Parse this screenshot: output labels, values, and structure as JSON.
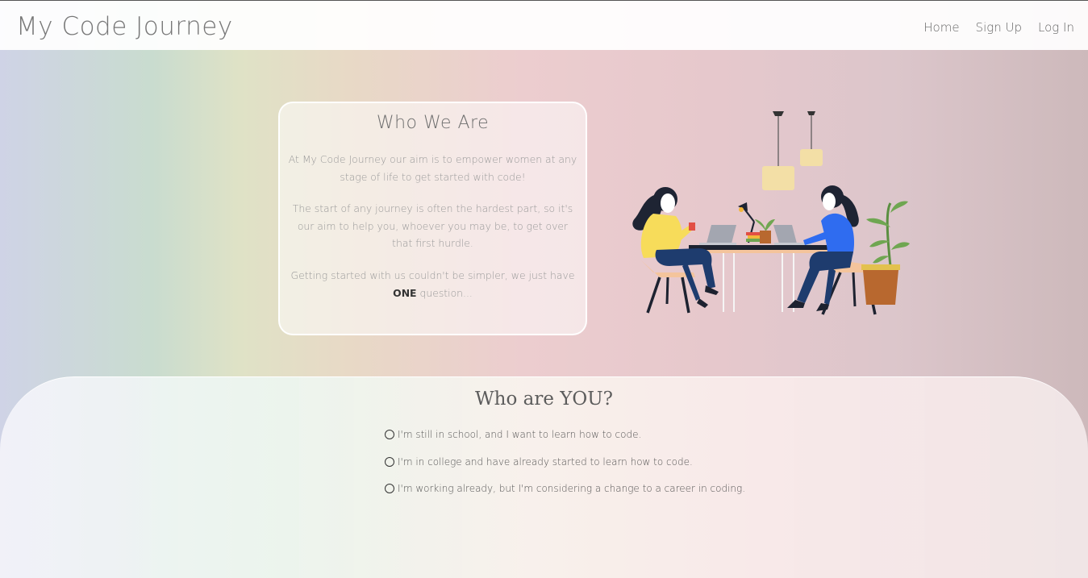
{
  "navbar": {
    "brand": "My Code Journey",
    "links": [
      {
        "label": "Home"
      },
      {
        "label": "Sign Up"
      },
      {
        "label": "Log In"
      }
    ]
  },
  "about": {
    "title": "Who We Are",
    "p1": "At My Code Journey our aim is to empower women at any stage of life to get started with code!",
    "p2": "The start of any journey is often the hardest part, so it's our aim to help you, whoever you may be, to get over that first hurdle.",
    "p3_start": "Getting started with us couldn't be simpler, we just have",
    "p3_strong": "ONE",
    "p3_end": "question..."
  },
  "illustration": {
    "icon": "women-coding-at-table-illustration",
    "colors": {
      "hair": "#1e2433",
      "yellow_top": "#f7dc5a",
      "blue_top": "#2f6cf0",
      "chair": "#f4c49c",
      "pot": "#b8682f",
      "lamp_shade": "#f3dfa6",
      "plant": "#6fa651"
    }
  },
  "quiz": {
    "title": "Who are YOU?",
    "options": [
      {
        "label": "I'm still in school, and I want to learn how to code."
      },
      {
        "label": "I'm in college and have already started to learn how to code."
      },
      {
        "label": "I'm working already, but I'm considering a change to a career in coding."
      }
    ]
  }
}
